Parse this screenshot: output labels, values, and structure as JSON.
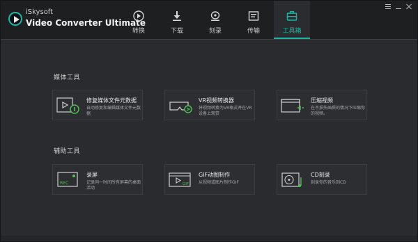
{
  "app": {
    "brand_top": "iSkysoft",
    "brand_name": "Video Converter Ultimate"
  },
  "nav": [
    {
      "label": "转换",
      "icon": "play-circle-icon",
      "active": false
    },
    {
      "label": "下载",
      "icon": "download-icon",
      "active": false
    },
    {
      "label": "刻录",
      "icon": "disc-burn-icon",
      "active": false
    },
    {
      "label": "传输",
      "icon": "transfer-icon",
      "active": false
    },
    {
      "label": "工具箱",
      "icon": "toolbox-icon",
      "active": true
    }
  ],
  "sections": {
    "media": "媒体工具",
    "aux": "辅助工具"
  },
  "media_tools": [
    {
      "title": "修复媒体文件元数据",
      "desc": "自动修复和编辑媒体文件元数据",
      "icon": "metadata-fix-icon"
    },
    {
      "title": "VR视频转换器",
      "desc": "将视频转换为VR格式并在VR设备上观赏",
      "icon": "vr-headset-icon"
    },
    {
      "title": "压缩视频",
      "desc": "在不损失画质的情况下压缩你的视频。",
      "icon": "compress-video-icon"
    }
  ],
  "aux_tools": [
    {
      "title": "录屏",
      "desc": "记录同一时间所有屏幕的桌面活动",
      "icon": "screen-record-icon"
    },
    {
      "title": "GIF动图制作",
      "desc": "从视频或图片制作GIF",
      "icon": "gif-maker-icon"
    },
    {
      "title": "CD刻录",
      "desc": "刻录你的音乐到CD",
      "icon": "cd-burn-icon"
    }
  ],
  "colors": {
    "accent": "#18b6a3",
    "background": "#2a2b2e",
    "card": "#2d2e32",
    "green_icon": "#4fbf57"
  }
}
